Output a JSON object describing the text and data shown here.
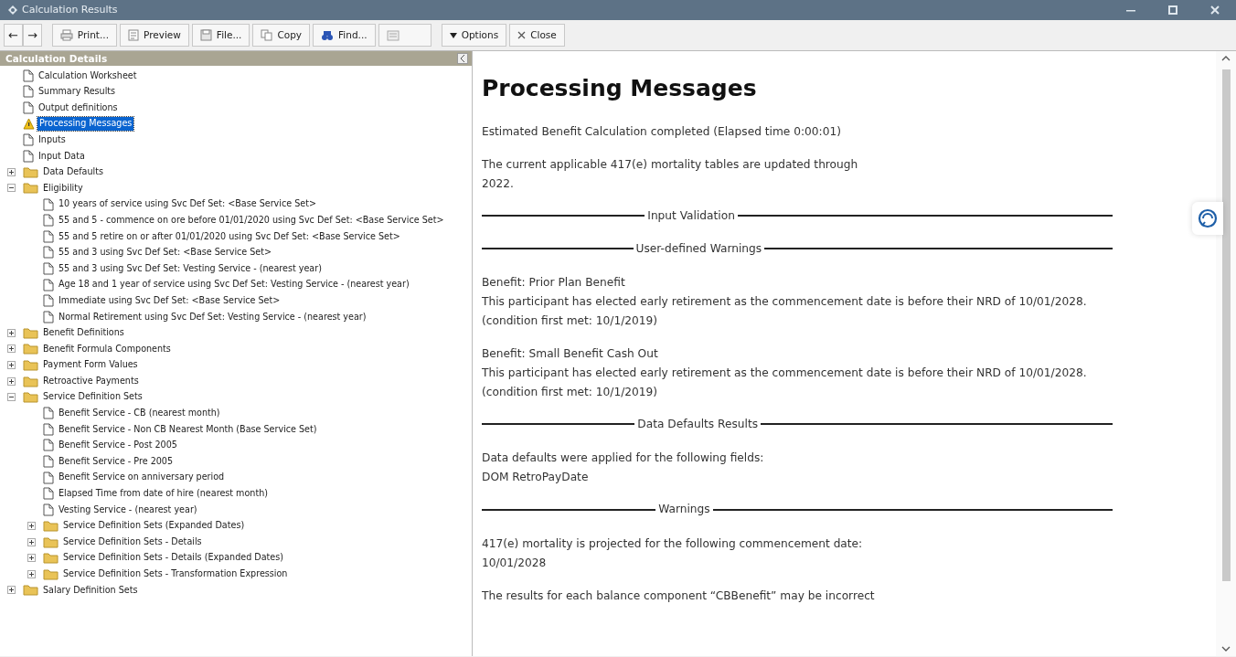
{
  "window": {
    "title": "Calculation Results"
  },
  "toolbar": [
    {
      "kind": "back",
      "label": "←",
      "disabled": false
    },
    {
      "kind": "forward",
      "label": "→",
      "disabled": false
    },
    {
      "kind": "print",
      "label": "Print...",
      "disabled": false
    },
    {
      "kind": "preview",
      "label": "Preview",
      "disabled": false
    },
    {
      "kind": "file",
      "label": "File...",
      "disabled": false
    },
    {
      "kind": "copy",
      "label": "Copy",
      "disabled": false
    },
    {
      "kind": "find",
      "label": "Find...",
      "disabled": false
    },
    {
      "kind": "review",
      "disabled": true
    },
    {
      "kind": "options",
      "label": "Options",
      "disabled": false
    },
    {
      "kind": "close",
      "label": "Close",
      "disabled": false
    }
  ],
  "sidebar": {
    "title": "Calculation Details",
    "items": [
      {
        "kind": "doc",
        "label": "Calculation Worksheet",
        "selected": false
      },
      {
        "kind": "doc",
        "label": "Summary Results",
        "selected": false
      },
      {
        "kind": "doc",
        "label": "Output definitions",
        "selected": false
      },
      {
        "kind": "warning",
        "label": "Processing Messages",
        "selected": true
      },
      {
        "kind": "doc",
        "label": "Inputs",
        "selected": false
      },
      {
        "kind": "doc",
        "label": "Input Data",
        "selected": false
      },
      {
        "kind": "folder",
        "label": "Data Defaults",
        "selected": false,
        "expanded": false
      },
      {
        "kind": "folder",
        "label": "Eligibility",
        "selected": false,
        "expanded": true,
        "children": [
          {
            "kind": "doc",
            "label": "10 years of service using Svc Def Set: <Base Service Set>",
            "selected": false
          },
          {
            "kind": "doc",
            "label": "55 and 5 - commence on ore before 01/01/2020 using Svc Def Set: <Base Service Set>",
            "selected": false
          },
          {
            "kind": "doc",
            "label": "55 and 5 retire on or after 01/01/2020 using Svc Def Set: <Base Service Set>",
            "selected": false
          },
          {
            "kind": "doc",
            "label": "55 and 3 using Svc Def Set: <Base Service Set>",
            "selected": false
          },
          {
            "kind": "doc",
            "label": "55 and 3 using Svc Def Set: Vesting Service - (nearest year)",
            "selected": false
          },
          {
            "kind": "doc",
            "label": "Age 18 and 1 year of service using Svc Def Set: Vesting Service - (nearest year)",
            "selected": false
          },
          {
            "kind": "doc",
            "label": "Immediate using Svc Def Set: <Base Service Set>",
            "selected": false
          },
          {
            "kind": "doc",
            "label": "Normal Retirement using Svc Def Set: Vesting Service - (nearest year)",
            "selected": false
          }
        ]
      },
      {
        "kind": "folder",
        "label": "Benefit Definitions",
        "selected": false,
        "expanded": false
      },
      {
        "kind": "folder",
        "label": "Benefit Formula Components",
        "selected": false,
        "expanded": false
      },
      {
        "kind": "folder",
        "label": "Payment Form Values",
        "selected": false,
        "expanded": false
      },
      {
        "kind": "folder",
        "label": "Retroactive Payments",
        "selected": false,
        "expanded": false
      },
      {
        "kind": "folder",
        "label": "Service Definition Sets",
        "selected": false,
        "expanded": true,
        "children": [
          {
            "kind": "doc",
            "label": "Benefit Service - CB (nearest month)",
            "selected": false
          },
          {
            "kind": "doc",
            "label": "Benefit Service - Non CB Nearest Month (Base Service Set)",
            "selected": false
          },
          {
            "kind": "doc",
            "label": "Benefit Service - Post 2005",
            "selected": false
          },
          {
            "kind": "doc",
            "label": "Benefit Service - Pre 2005",
            "selected": false
          },
          {
            "kind": "doc",
            "label": "Benefit Service on anniversary period",
            "selected": false
          },
          {
            "kind": "doc",
            "label": "Elapsed Time from date of hire (nearest month)",
            "selected": false
          },
          {
            "kind": "doc",
            "label": "Vesting Service - (nearest year)",
            "selected": false
          },
          {
            "kind": "folder",
            "label": "Service Definition Sets (Expanded Dates)",
            "selected": false,
            "expanded": false
          },
          {
            "kind": "folder",
            "label": "Service Definition Sets - Details",
            "selected": false,
            "expanded": false
          },
          {
            "kind": "folder",
            "label": "Service Definition Sets - Details (Expanded Dates)",
            "selected": false,
            "expanded": false
          },
          {
            "kind": "folder",
            "label": "Service Definition Sets - Transformation Expression",
            "selected": false,
            "expanded": false
          }
        ]
      },
      {
        "kind": "folder",
        "label": "Salary Definition Sets",
        "selected": false,
        "expanded": false
      }
    ]
  },
  "content": {
    "heading": "Processing Messages",
    "blocks": [
      {
        "kind": "para",
        "lines": [
          "Estimated Benefit Calculation completed (Elapsed time 0:00:01)"
        ]
      },
      {
        "kind": "para",
        "lines": [
          "The current applicable 417(e) mortality tables are updated through",
          "2022."
        ]
      },
      {
        "kind": "section",
        "label": "Input Validation"
      },
      {
        "kind": "section",
        "label": "User-defined Warnings"
      },
      {
        "kind": "para",
        "lines": [
          "Benefit: Prior Plan Benefit",
          "This participant has elected early retirement as the commencement date is before their NRD of 10/01/2028.",
          "(condition first met: 10/1/2019)"
        ]
      },
      {
        "kind": "para",
        "lines": [
          "Benefit: Small Benefit Cash Out",
          "This participant has elected early retirement as the commencement date is before their NRD of 10/01/2028.",
          "(condition first met: 10/1/2019)"
        ]
      },
      {
        "kind": "section",
        "label": "Data Defaults Results"
      },
      {
        "kind": "para",
        "lines": [
          "Data defaults were applied for the following fields:",
          "DOM RetroPayDate"
        ]
      },
      {
        "kind": "section",
        "label": "Warnings"
      },
      {
        "kind": "para",
        "lines": [
          "417(e) mortality is projected for the following commencement date:",
          "10/01/2028"
        ]
      },
      {
        "kind": "para",
        "lines": [
          "The results for each balance component “CBBenefit” may be incorrect"
        ]
      }
    ]
  }
}
